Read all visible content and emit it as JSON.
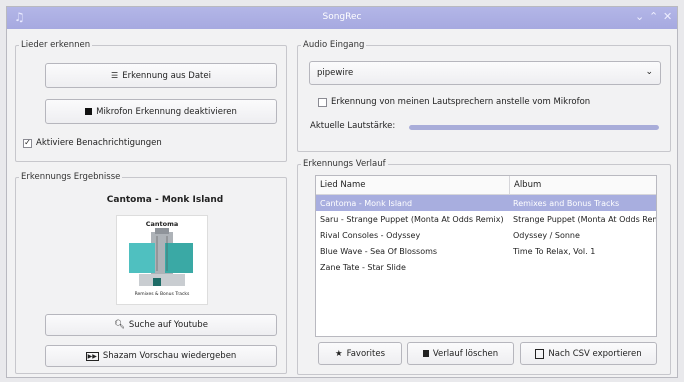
{
  "window": {
    "title": "SongRec",
    "app_icon": "music-note-icon"
  },
  "left": {
    "recognize_group": "Lieder erkennen",
    "from_file_button": "Erkennung aus Datei",
    "mic_button": "Mikrofon Erkennung deaktivieren",
    "notifications_label": "Aktiviere Benachrichtigungen",
    "results_group": "Erkennungs Ergebnisse",
    "song_title": "Cantoma - Monk Island",
    "cover_title": "Cantoma",
    "cover_subtitle": "Remixes & Bonus Tracks",
    "youtube_button": "Suche auf Youtube",
    "shazam_button": "Shazam Vorschau wiedergeben"
  },
  "right": {
    "audio_group": "Audio Eingang",
    "device_value": "pipewire",
    "speakers_label": "Erkennung von meinen Lautsprechern anstelle vom Mikrofon",
    "volume_label": "Aktuelle Lautstärke:",
    "volume_level": 1.0,
    "history_group": "Erkennungs Verlauf",
    "table_headers": [
      "Lied Name",
      "Album"
    ],
    "rows": [
      {
        "song": "Cantoma - Monk Island",
        "album": "Remixes and Bonus Tracks"
      },
      {
        "song": "Saru - Strange Puppet (Monta At Odds Remix)",
        "album": "Strange Puppet (Monta At Odds Rem"
      },
      {
        "song": "Rival Consoles - Odyssey",
        "album": "Odyssey / Sonne"
      },
      {
        "song": "Blue Wave - Sea Of Blossoms",
        "album": "Time To Relax, Vol. 1"
      },
      {
        "song": "Zane Tate - Star Slide",
        "album": ""
      }
    ],
    "favorites_button": "Favorites",
    "clear_button": "Verlauf löschen",
    "export_button": "Nach CSV exportieren"
  },
  "colors": {
    "accent": "#a6a9e0",
    "selection": "#a8aedf",
    "volume_bar": "#a9add9"
  }
}
